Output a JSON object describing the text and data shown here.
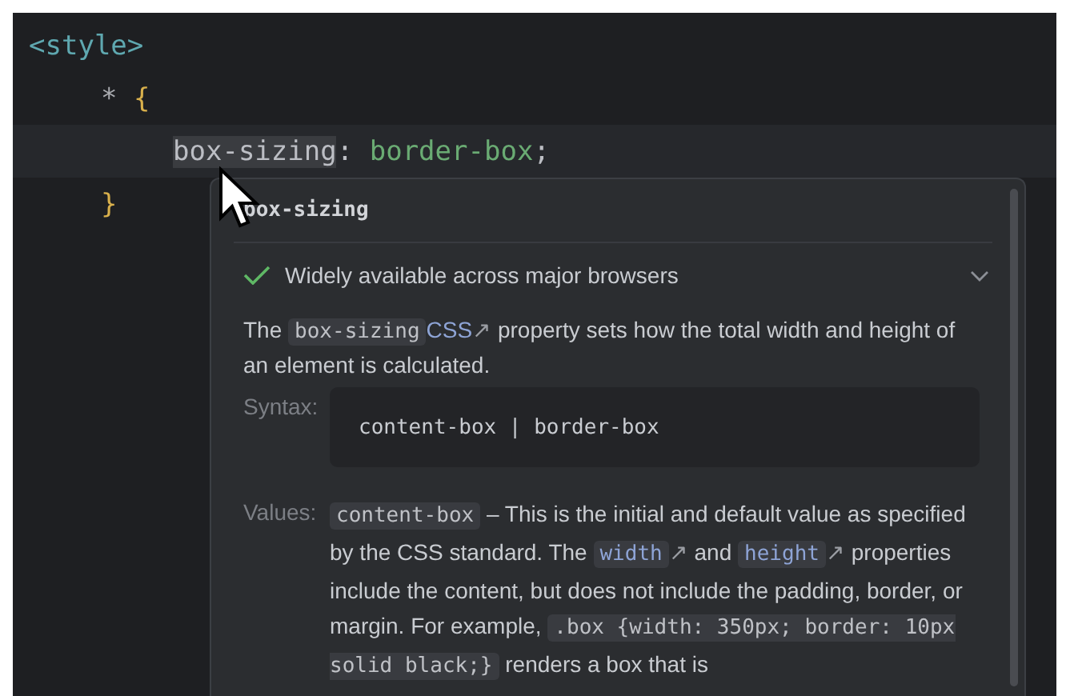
{
  "editor": {
    "lines": [
      {
        "tokens": [
          {
            "kind": "tag",
            "text": "<style>",
            "hovered": false
          }
        ],
        "children": [
          {
            "tokens": [
              {
                "kind": "selector",
                "text": "* ",
                "hovered": false
              },
              {
                "kind": "brace",
                "text": "{",
                "hovered": false
              }
            ],
            "children": [
              {
                "tokens": [
                  {
                    "kind": "property",
                    "text": "box-sizing",
                    "hovered": true
                  },
                  {
                    "kind": "punct",
                    "text": ": ",
                    "hovered": false
                  },
                  {
                    "kind": "value",
                    "text": "border-box",
                    "hovered": false
                  },
                  {
                    "kind": "punct",
                    "text": ";",
                    "hovered": false
                  }
                ]
              }
            ]
          },
          {
            "tokens": [
              {
                "kind": "brace",
                "text": "}",
                "hovered": false
              }
            ]
          }
        ]
      }
    ]
  },
  "popup": {
    "title": "box-sizing",
    "availability": {
      "text": "Widely available across major browsers",
      "expanded": false
    },
    "description": [
      {
        "kind": "text",
        "text": "The "
      },
      {
        "kind": "code",
        "text": "box-sizing"
      },
      {
        "kind": "link",
        "text": "CSS",
        "icon": "↗"
      },
      {
        "kind": "text",
        "text": " property sets how the total width and height of an element is calculated."
      }
    ],
    "syntax": {
      "label": "Syntax:",
      "code": "content-box | border-box"
    },
    "values": {
      "label": "Values:",
      "parts": [
        {
          "kind": "code",
          "text": "content-box"
        },
        {
          "kind": "text",
          "text": " – This is the initial and default value as specified by the CSS standard. The "
        },
        {
          "kind": "codelink",
          "text": "width",
          "icon": "↗"
        },
        {
          "kind": "text",
          "text": " and "
        },
        {
          "kind": "codelink",
          "text": "height",
          "icon": "↗"
        },
        {
          "kind": "text",
          "text": " properties include the content, but does not include the padding, border, or margin. For example, "
        },
        {
          "kind": "code",
          "text": ".box {width: 350px; border: 10px solid black;}"
        },
        {
          "kind": "text",
          "text": " renders a box that is"
        }
      ]
    }
  }
}
